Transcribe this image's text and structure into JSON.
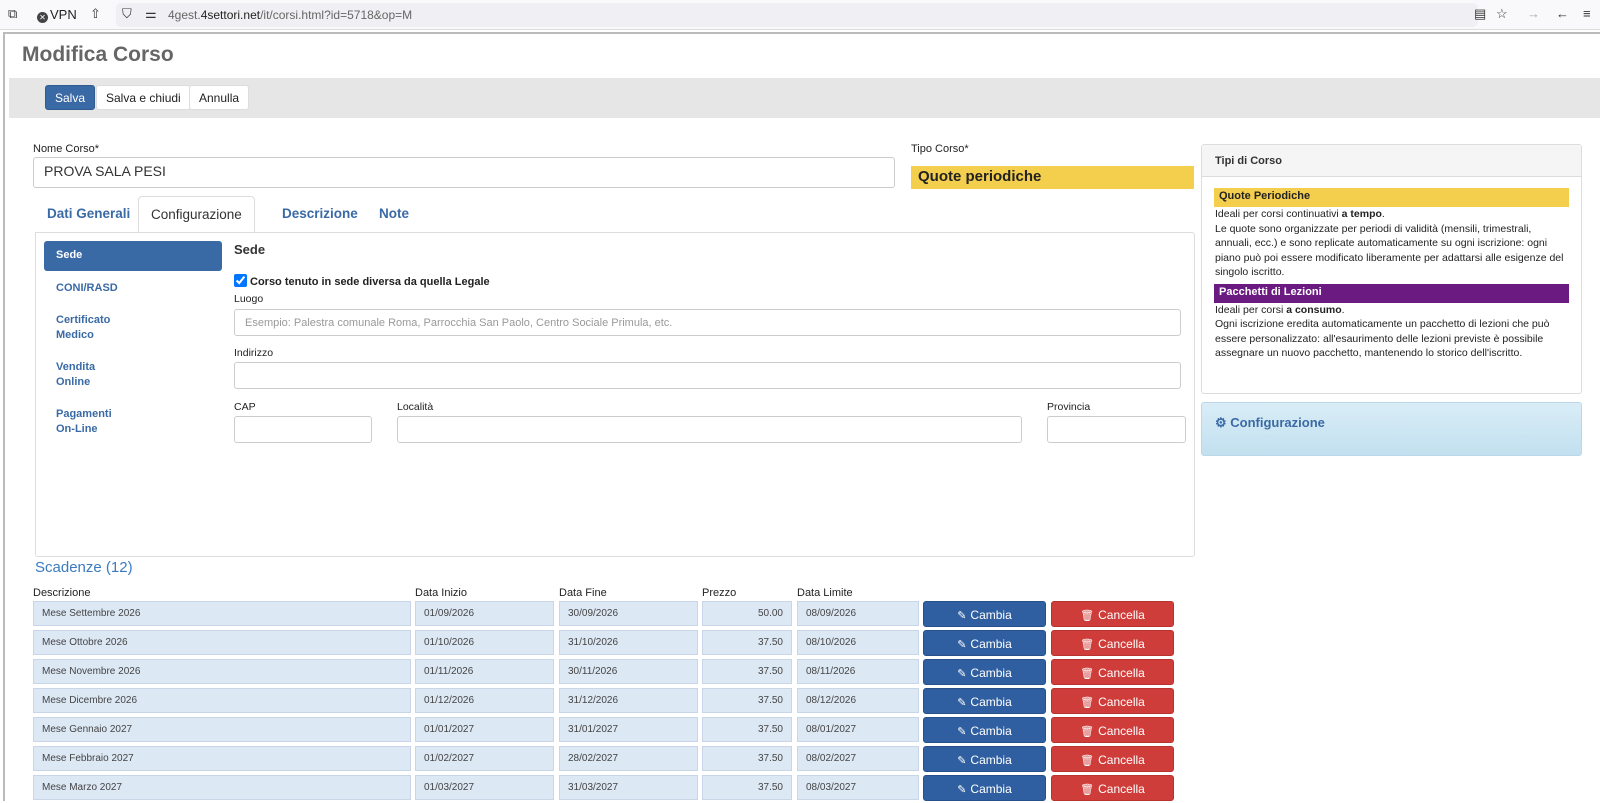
{
  "browser": {
    "vpn_label": "VPN",
    "url_prefix": "4gest.",
    "url_domain": "4settori.net",
    "url_path": "/it/corsi.html?id=5718&op=M"
  },
  "page": {
    "title": "Modifica Corso",
    "toolbar": {
      "save": "Salva",
      "save_close": "Salva e chiudi",
      "cancel": "Annulla"
    }
  },
  "form": {
    "nome_label": "Nome Corso*",
    "nome_value": "PROVA SALA PESI",
    "tipo_label": "Tipo Corso*",
    "tipo_value": "Quote periodiche"
  },
  "tabs": [
    "Dati Generali",
    "Configurazione",
    "Descrizione",
    "Note"
  ],
  "sidebar": [
    {
      "label": "Sede"
    },
    {
      "label": "CONI/RASD"
    },
    {
      "label": "Certificato Medico"
    },
    {
      "label": "Vendita Online"
    },
    {
      "label": "Pagamenti On-Line"
    }
  ],
  "sede": {
    "heading": "Sede",
    "checkbox_label": "Corso tenuto in sede diversa da quella Legale",
    "luogo_label": "Luogo",
    "luogo_placeholder": "Esempio: Palestra comunale Roma, Parrocchia San Paolo, Centro Sociale Primula, etc.",
    "indirizzo_label": "Indirizzo",
    "cap_label": "CAP",
    "localita_label": "Località",
    "provincia_label": "Provincia"
  },
  "tipi": {
    "heading": "Tipi di Corso",
    "quote_title": "Quote Periodiche",
    "quote_line1_pre": "Ideali per corsi continuativi ",
    "quote_line1_bold": "a tempo",
    "quote_line1_post": ".",
    "quote_text": "Le quote sono organizzate per periodi di validità (mensili, trimestrali, annuali, ecc.) e sono replicate automaticamente su ogni iscrizione: ogni piano può poi essere modificato liberamente per adattarsi alle esigenze del singolo iscritto.",
    "pacchetti_title": "Pacchetti di Lezioni",
    "pacchetti_line1_pre": "Ideali per corsi ",
    "pacchetti_line1_bold": "a consumo",
    "pacchetti_line1_post": ".",
    "pacchetti_text": "Ogni iscrizione eredita automaticamente un pacchetto di lezioni che può essere personalizzato: all'esaurimento delle lezioni previste è possibile assegnare un nuovo pacchetto, mantenendo lo storico dell'iscritto.",
    "config_label": "Configurazione"
  },
  "scadenze": {
    "heading": "Scadenze (12)",
    "columns": [
      "Descrizione",
      "Data Inizio",
      "Data Fine",
      "Prezzo",
      "Data Limite"
    ],
    "edit_label": "Cambia",
    "delete_label": "Cancella",
    "rows": [
      [
        "Mese Settembre 2026",
        "01/09/2026",
        "30/09/2026",
        "50.00",
        "08/09/2026"
      ],
      [
        "Mese Ottobre 2026",
        "01/10/2026",
        "31/10/2026",
        "37.50",
        "08/10/2026"
      ],
      [
        "Mese Novembre 2026",
        "01/11/2026",
        "30/11/2026",
        "37.50",
        "08/11/2026"
      ],
      [
        "Mese Dicembre 2026",
        "01/12/2026",
        "31/12/2026",
        "37.50",
        "08/12/2026"
      ],
      [
        "Mese Gennaio 2027",
        "01/01/2027",
        "31/01/2027",
        "37.50",
        "08/01/2027"
      ],
      [
        "Mese Febbraio 2027",
        "01/02/2027",
        "28/02/2027",
        "37.50",
        "08/02/2027"
      ],
      [
        "Mese Marzo 2027",
        "01/03/2027",
        "31/03/2027",
        "37.50",
        "08/03/2027"
      ]
    ]
  }
}
